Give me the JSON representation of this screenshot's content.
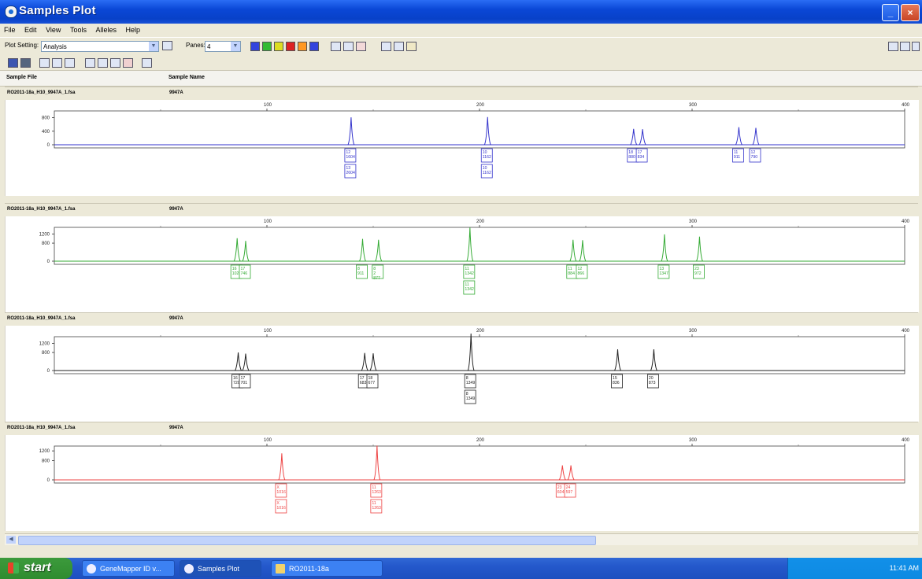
{
  "window": {
    "title": "Samples Plot"
  },
  "menu": [
    "File",
    "Edit",
    "View",
    "Tools",
    "Alleles",
    "Help"
  ],
  "toolbar": {
    "plot_setting_label": "Plot Setting:",
    "plot_setting_value": "Analysis",
    "panes_label": "Panes:",
    "panes_value": "4"
  },
  "table_header": {
    "sample_file": "Sample File",
    "sample_name": "Sample Name"
  },
  "panels": [
    {
      "sample_file": "RO2011-18a_H10_9947A_1.fsa",
      "sample_name": "9947A",
      "color": "#3333cc",
      "y_ticks": [
        "800",
        "400",
        "0"
      ],
      "y_max": 1000,
      "x_ticks": [
        "100",
        "200",
        "300",
        "400"
      ],
      "peaks": [
        {
          "size": 139.6,
          "height": 810,
          "labels": [
            "12|1604",
            "13|2604"
          ]
        },
        {
          "size": 203.8,
          "height": 820,
          "labels": [
            "10|1162",
            "10|1162"
          ]
        },
        {
          "size": 272.5,
          "height": 470,
          "labels": [
            "18|880"
          ]
        },
        {
          "size": 276.7,
          "height": 460,
          "labels": [
            "17|834"
          ]
        },
        {
          "size": 322.0,
          "height": 520,
          "labels": [
            "11|911"
          ]
        },
        {
          "size": 330.0,
          "height": 500,
          "labels": [
            "12|790"
          ]
        }
      ]
    },
    {
      "sample_file": "RO2011-18a_H10_9947A_1.fsa",
      "sample_name": "9947A",
      "color": "#33aa33",
      "y_ticks": [
        "1200",
        "800",
        "0"
      ],
      "y_max": 1500,
      "x_ticks": [
        "100",
        "200",
        "300",
        "400"
      ],
      "peaks": [
        {
          "size": 86.0,
          "height": 1020,
          "labels": [
            "16|1020"
          ]
        },
        {
          "size": 90.0,
          "height": 900,
          "labels": [
            "17|746"
          ]
        },
        {
          "size": 145.0,
          "height": 990,
          "labels": [
            "8|911"
          ]
        },
        {
          "size": 152.5,
          "height": 950,
          "labels": [
            "8|2|877"
          ]
        },
        {
          "size": 195.5,
          "height": 1490,
          "labels": [
            "11|1342",
            "11|1342"
          ]
        },
        {
          "size": 244.0,
          "height": 950,
          "labels": [
            "11|884"
          ]
        },
        {
          "size": 248.5,
          "height": 930,
          "labels": [
            "12|866"
          ]
        },
        {
          "size": 287.0,
          "height": 1190,
          "labels": [
            "13|1347"
          ]
        },
        {
          "size": 303.5,
          "height": 1090,
          "labels": [
            "23|972"
          ]
        }
      ]
    },
    {
      "sample_file": "RO2011-18a_H10_9947A_1.fsa",
      "sample_name": "9947A",
      "color": "#222222",
      "y_ticks": [
        "1200",
        "800",
        "0"
      ],
      "y_max": 1500,
      "x_ticks": [
        "100",
        "200",
        "300",
        "400"
      ],
      "peaks": [
        {
          "size": 86.5,
          "height": 800,
          "labels": [
            "16|720"
          ]
        },
        {
          "size": 90.0,
          "height": 750,
          "labels": [
            "17|701"
          ]
        },
        {
          "size": 146.0,
          "height": 780,
          "labels": [
            "17|683"
          ]
        },
        {
          "size": 150.0,
          "height": 760,
          "labels": [
            "18|677"
          ]
        },
        {
          "size": 196.0,
          "height": 1640,
          "labels": [
            "8|1349",
            "8|1349"
          ]
        },
        {
          "size": 265.0,
          "height": 940,
          "labels": [
            "15|836"
          ]
        },
        {
          "size": 282.0,
          "height": 940,
          "labels": [
            "20|873"
          ]
        }
      ]
    },
    {
      "sample_file": "RO2011-18a_H10_9947A_1.fsa",
      "sample_name": "9947A",
      "color": "#ee4444",
      "y_ticks": [
        "1200",
        "800",
        "0"
      ],
      "y_max": 1400,
      "x_ticks": [
        "100",
        "200",
        "300",
        "400"
      ],
      "peaks": [
        {
          "size": 107.0,
          "height": 1100,
          "labels": [
            "X|1016",
            "X|1016"
          ]
        },
        {
          "size": 151.8,
          "height": 1420,
          "labels": [
            "11|1263",
            "11|1263"
          ]
        },
        {
          "size": 239.0,
          "height": 600,
          "labels": [
            "23|604"
          ]
        },
        {
          "size": 243.0,
          "height": 600,
          "labels": [
            "24|597"
          ]
        }
      ]
    }
  ],
  "taskbar": {
    "start": "start",
    "tasks": [
      "GeneMapper ID v...",
      "Samples Plot",
      "RO2011-18a"
    ],
    "clock": "11:41 AM"
  }
}
